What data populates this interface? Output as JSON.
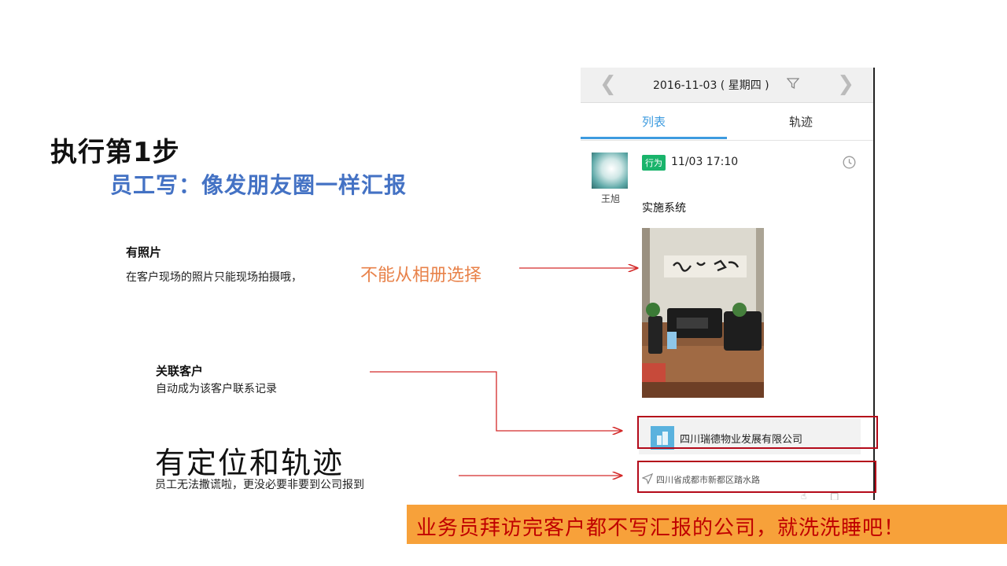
{
  "slide": {
    "title": "执行第1步",
    "subtitle": "员工写：像发朋友圈一样汇报"
  },
  "notes": {
    "photo": {
      "heading": "有照片",
      "body": "在客户现场的照片只能现场拍摄哦，",
      "emphasis": "不能从相册选择"
    },
    "customer": {
      "heading": "关联客户",
      "body": "自动成为该客户联系记录"
    },
    "location": {
      "heading": "有定位和轨迹",
      "body": "员工无法撒谎啦，更没必要非要到公司报到"
    }
  },
  "phone": {
    "date_bar": {
      "prev_icon": "chevron-left-icon",
      "date": "2016-11-03 ( 星期四 )",
      "filter_icon": "filter-icon",
      "next_icon": "chevron-right-icon"
    },
    "tabs": [
      {
        "label": "列表",
        "active": true
      },
      {
        "label": "轨迹",
        "active": false
      }
    ],
    "post": {
      "author": "王旭",
      "tag": "行为",
      "time": "11/03 17:10",
      "content": "实施系统",
      "customer": "四川瑞德物业发展有限公司",
      "location": "四川省成都市新都区踏水路"
    }
  },
  "banner": {
    "text": "业务员拜访完客户都不写汇报的公司，就洗洗睡吧！"
  },
  "colors": {
    "title_blue": "#4472c4",
    "emphasis_orange": "#e8824a",
    "highlight_red": "#b40a1a",
    "banner_bg": "#f7a13a",
    "banner_text": "#c00000",
    "tab_active": "#3d9bdf",
    "tag_green": "#19b46b"
  }
}
